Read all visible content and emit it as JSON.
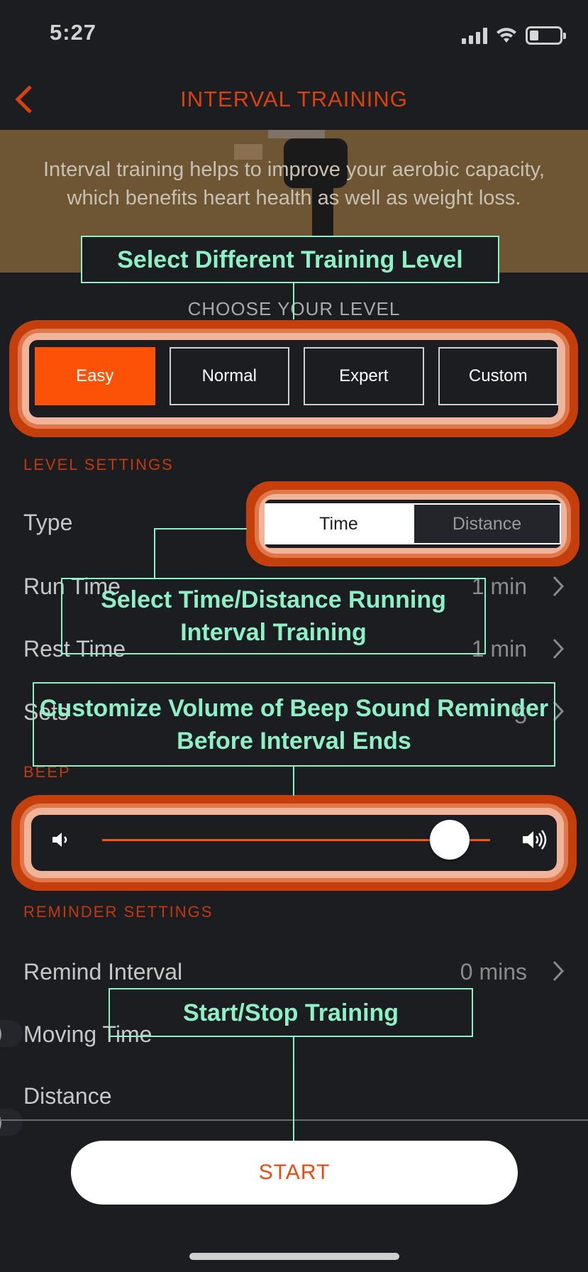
{
  "status_bar": {
    "time": "5:27"
  },
  "nav": {
    "title": "INTERVAL TRAINING"
  },
  "hero": {
    "description": "Interval training helps to improve your aerobic capacity, which benefits heart health as well as weight loss."
  },
  "choose_level": {
    "heading": "CHOOSE YOUR LEVEL",
    "options": [
      {
        "label": "Easy",
        "selected": true
      },
      {
        "label": "Normal",
        "selected": false
      },
      {
        "label": "Expert",
        "selected": false
      },
      {
        "label": "Custom",
        "selected": false
      }
    ]
  },
  "level_settings": {
    "heading": "LEVEL SETTINGS",
    "type": {
      "label": "Type",
      "options": [
        "Time",
        "Distance"
      ],
      "selected": "Time"
    },
    "rows": [
      {
        "label": "Run Time",
        "value": "1 min"
      },
      {
        "label": "Rest Time",
        "value": "1 min"
      },
      {
        "label": "Sets",
        "value": "5"
      }
    ]
  },
  "beep": {
    "heading": "BEEP",
    "volume_fraction": 0.92
  },
  "reminder_settings": {
    "heading": "REMINDER SETTINGS",
    "remind_interval": {
      "label": "Remind Interval",
      "value": "0 mins"
    },
    "moving_time": {
      "label": "Moving Time",
      "enabled": false
    },
    "distance": {
      "label": "Distance",
      "enabled": false
    }
  },
  "start_button": {
    "label": "START"
  },
  "callouts": {
    "level": "Select Different Training Level",
    "type": "Select Time/Distance Running Interval Training",
    "beep": "Customize Volume of Beep Sound Reminder Before Interval Ends",
    "start": "Start/Stop Training"
  },
  "colors": {
    "accent": "#fb5208",
    "title": "#d9420c",
    "callout": "#8ef0c6",
    "background": "#1c1d20"
  },
  "icons": [
    "back-chevron-icon",
    "signal-icon",
    "wifi-icon",
    "battery-icon",
    "chevron-right-icon",
    "volume-low-icon",
    "volume-high-icon"
  ]
}
